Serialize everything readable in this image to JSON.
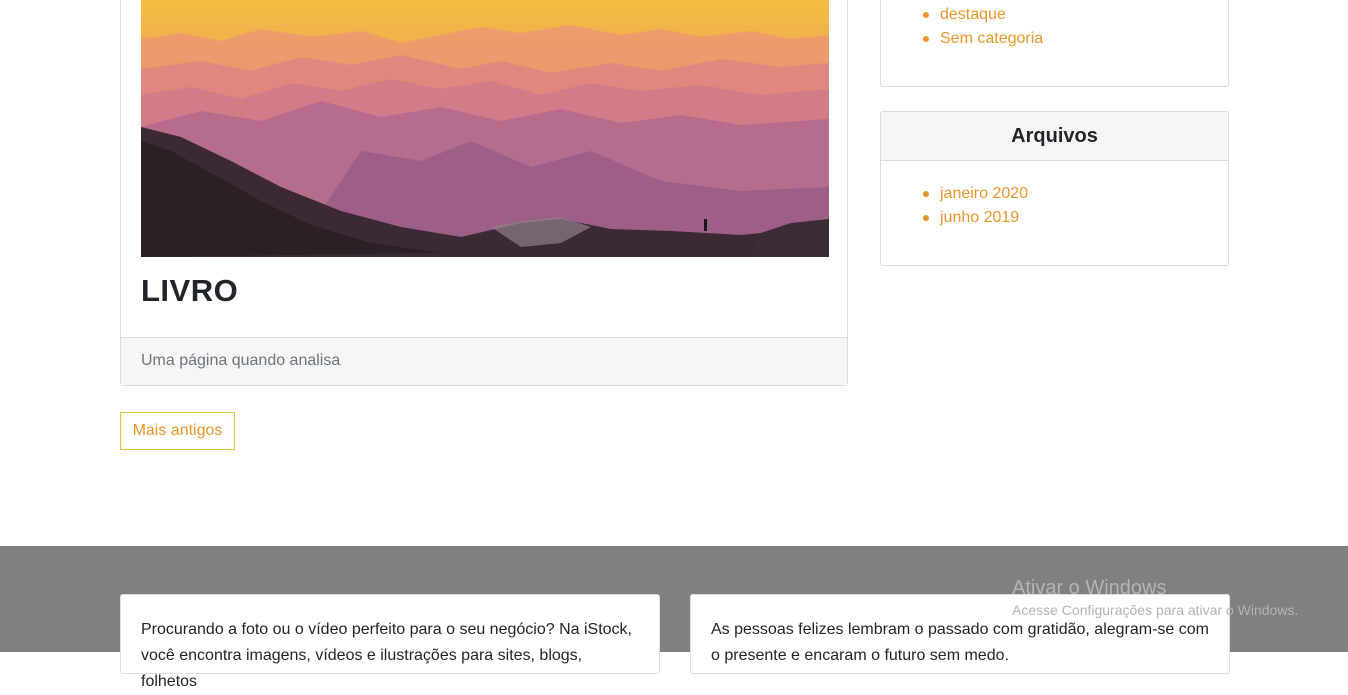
{
  "post": {
    "title": "LIVRO",
    "excerpt": "Uma página quando analisa"
  },
  "pagination": {
    "older_label": "Mais antigos"
  },
  "sidebar": {
    "categories": {
      "items": [
        "destaque",
        "Sem categoria"
      ]
    },
    "archives": {
      "title": "Arquivos",
      "items": [
        "janeiro 2020",
        "junho 2019"
      ]
    }
  },
  "footer": {
    "cards": [
      {
        "text": "Procurando a foto ou o vídeo perfeito para o seu negócio? Na iStock, você encontra imagens, vídeos e ilustrações para sites, blogs, folhetos"
      },
      {
        "text": "As pessoas felizes lembram o passado com gratidão, alegram-se com o presente e encaram o futuro sem medo."
      }
    ]
  },
  "watermark": {
    "title": "Ativar o Windows",
    "subtitle": "Acesse Configurações para ativar o Windows."
  },
  "colors": {
    "accent": "#e8962a",
    "button_border": "#e9c23a",
    "footer_bg": "#808080"
  }
}
